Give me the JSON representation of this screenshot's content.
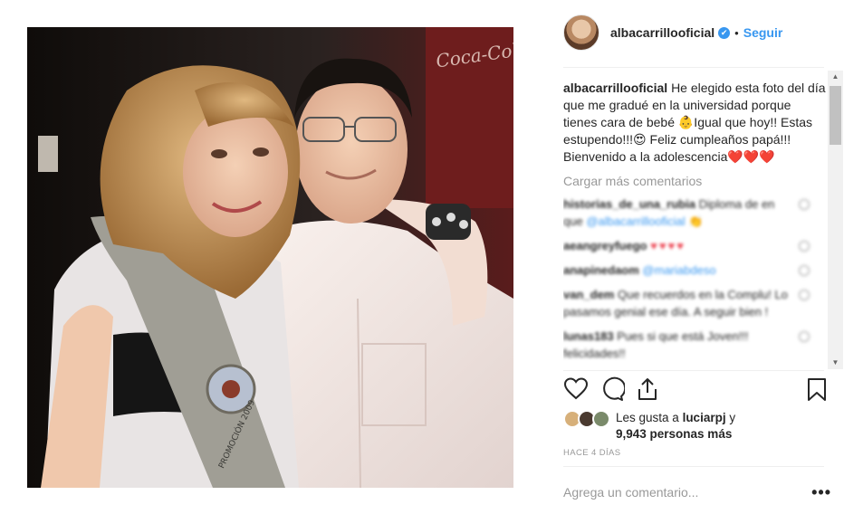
{
  "post": {
    "photo_alt": "",
    "photo_sign_text": "Coca-Cola",
    "sash_text": "PROMOCIÓN 2009"
  },
  "header": {
    "username": "albacarrillooficial",
    "verified_glyph": "✔",
    "separator": "•",
    "follow_label": "Seguir"
  },
  "caption": {
    "username": "albacarrillooficial",
    "text": "He elegido esta foto del día que me gradué en la universidad porque tienes cara de bebé 👶Igual que hoy!! Estas estupendo!!!😍 Feliz cumpleaños papá!!! Bienvenido a la adolescencia❤️❤️❤️"
  },
  "load_more_label": "Cargar más comentarios",
  "comments": [
    {
      "user": "historias_de_una_rubia",
      "text": "Diploma de en que ",
      "mention": "@albacarrillooficial",
      "tail": " 👏"
    },
    {
      "user": "aeangreyfuego",
      "text": "",
      "hearts": "♥♥♥♥"
    },
    {
      "user": "anapinedaom",
      "text": "",
      "mention": "@mariabdeso"
    },
    {
      "user": "van_dem",
      "text": "Que recuerdos en la Complu! Lo pasamos genial ese día. A seguir bien !"
    },
    {
      "user": "lunas183",
      "text": "Pues si que está Joven!!! felicidades!!"
    }
  ],
  "icons": {
    "like": "heart-icon",
    "comment": "comment-icon",
    "share": "share-icon",
    "save": "bookmark-icon"
  },
  "likes": {
    "prefix": "Les gusta a ",
    "user": "luciarpj",
    "suffix": " y",
    "count_text": "9,943 personas más"
  },
  "timestamp": "HACE 4 DÍAS",
  "comment_input": {
    "placeholder": "Agrega un comentario..."
  },
  "more_label": "•••",
  "colors": {
    "accent": "#3897f0",
    "text": "#262626",
    "muted": "#999999",
    "heart": "#ed4956"
  }
}
